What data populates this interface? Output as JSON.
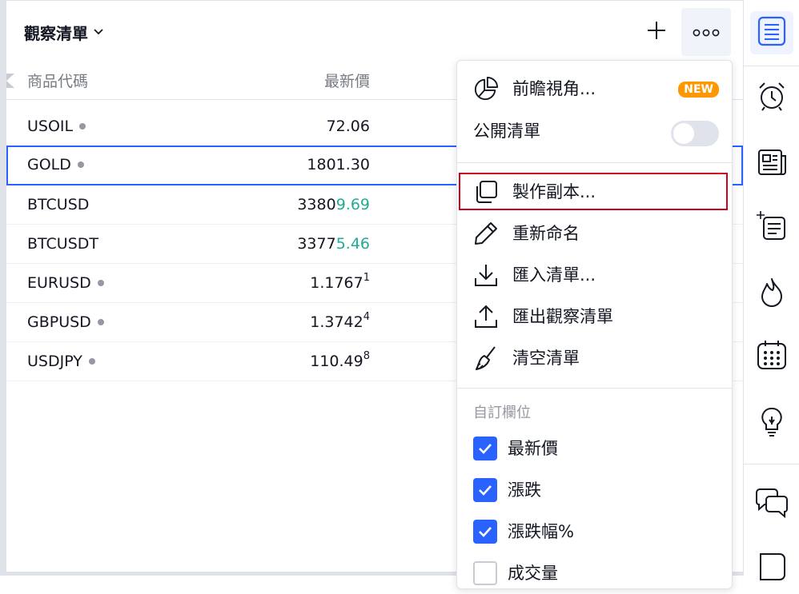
{
  "header": {
    "title": "觀察清單"
  },
  "columns": {
    "symbol": "商品代碼",
    "last": "最新價"
  },
  "rows": [
    {
      "symbol": "USOIL",
      "dot": true,
      "price_main": "72.06",
      "price_chg": "",
      "price_sup": ""
    },
    {
      "symbol": "GOLD",
      "dot": true,
      "price_main": "1801.30",
      "price_chg": "",
      "price_sup": "",
      "selected": true
    },
    {
      "symbol": "BTCUSD",
      "dot": false,
      "price_main": "3380",
      "price_chg": "9.69",
      "price_sup": ""
    },
    {
      "symbol": "BTCUSDT",
      "dot": false,
      "price_main": "3377",
      "price_chg": "5.46",
      "price_sup": ""
    },
    {
      "symbol": "EURUSD",
      "dot": true,
      "price_main": "1.1767",
      "price_chg": "",
      "price_sup": "1"
    },
    {
      "symbol": "GBPUSD",
      "dot": true,
      "price_main": "1.3742",
      "price_chg": "",
      "price_sup": "4"
    },
    {
      "symbol": "USDJPY",
      "dot": true,
      "price_main": "110.49",
      "price_chg": "",
      "price_sup": "8"
    }
  ],
  "menu": {
    "perspective": {
      "label": "前瞻視角...",
      "badge": "NEW"
    },
    "public_list": {
      "label": "公開清單",
      "enabled": false
    },
    "make_copy": {
      "label": "製作副本..."
    },
    "rename": {
      "label": "重新命名"
    },
    "import": {
      "label": "匯入清單..."
    },
    "export": {
      "label": "匯出觀察清單"
    },
    "clear": {
      "label": "清空清單"
    },
    "custom_columns": {
      "title": "自訂欄位",
      "items": [
        {
          "label": "最新價",
          "checked": true
        },
        {
          "label": "漲跌",
          "checked": true
        },
        {
          "label": "漲跌幅%",
          "checked": true
        },
        {
          "label": "成交量",
          "checked": false
        }
      ]
    }
  },
  "colors": {
    "accent": "#2962ff",
    "positive": "#22ab94",
    "badge": "#ff9800",
    "highlight": "#d0021b"
  }
}
